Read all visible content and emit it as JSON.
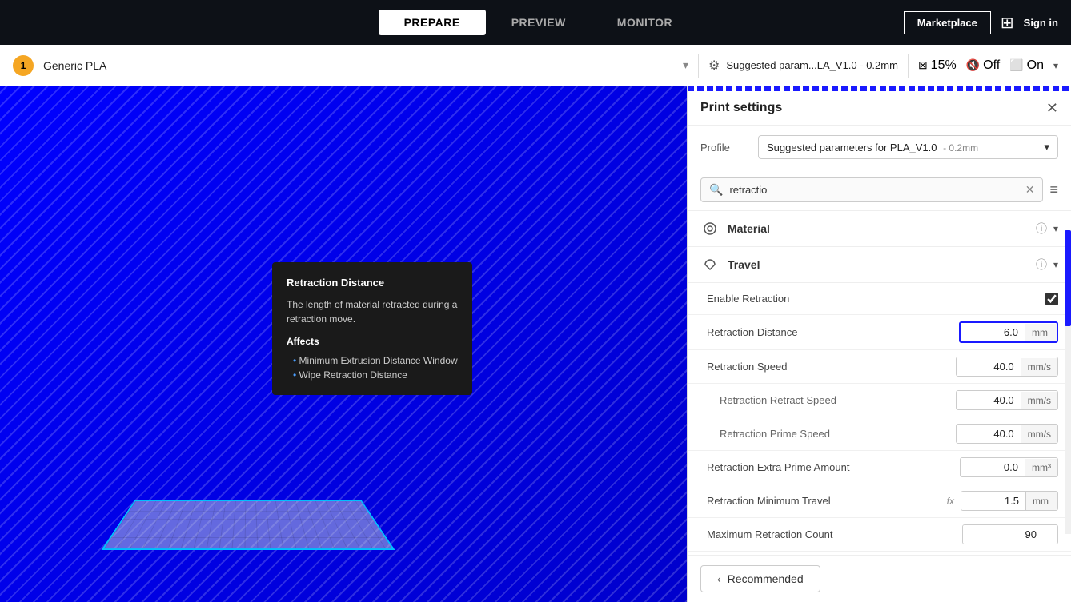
{
  "nav": {
    "tabs": [
      {
        "id": "prepare",
        "label": "PREPARE",
        "active": true
      },
      {
        "id": "preview",
        "label": "PREVIEW",
        "active": false
      },
      {
        "id": "monitor",
        "label": "MONITOR",
        "active": false
      }
    ],
    "marketplace_label": "Marketplace",
    "sign_in_label": "Sign in"
  },
  "toolbar": {
    "material_name": "Generic PLA",
    "suggested_params_text": "Suggested param...LA_V1.0 - 0.2mm",
    "infill_percent": "15%",
    "supports_label": "Off",
    "adhesion_label": "On"
  },
  "tooltip": {
    "title": "Retraction Distance",
    "description": "The length of material retracted during a retraction move.",
    "affects_label": "Affects",
    "affects_items": [
      "Minimum Extrusion Distance Window",
      "Wipe Retraction Distance"
    ]
  },
  "panel": {
    "title": "Print settings",
    "profile_label": "Profile",
    "profile_value": "Suggested parameters for PLA_V1.0",
    "profile_version": "- 0.2mm",
    "search_placeholder": "retractio",
    "sections": [
      {
        "id": "material",
        "label": "Material",
        "icon": "material-icon"
      },
      {
        "id": "travel",
        "label": "Travel",
        "icon": "travel-icon"
      }
    ],
    "settings": [
      {
        "id": "enable_retraction",
        "label": "Enable Retraction",
        "type": "checkbox",
        "value": true,
        "indented": false
      },
      {
        "id": "retraction_distance",
        "label": "Retraction Distance",
        "type": "number",
        "value": "6.0",
        "unit": "mm",
        "indented": false,
        "highlighted": true
      },
      {
        "id": "retraction_speed",
        "label": "Retraction Speed",
        "type": "number",
        "value": "40.0",
        "unit": "mm/s",
        "indented": false
      },
      {
        "id": "retraction_retract_speed",
        "label": "Retraction Retract Speed",
        "type": "number",
        "value": "40.0",
        "unit": "mm/s",
        "indented": true
      },
      {
        "id": "retraction_prime_speed",
        "label": "Retraction Prime Speed",
        "type": "number",
        "value": "40.0",
        "unit": "mm/s",
        "indented": true
      },
      {
        "id": "retraction_extra_prime_amount",
        "label": "Retraction Extra Prime Amount",
        "type": "number",
        "value": "0.0",
        "unit": "mm³",
        "indented": false
      },
      {
        "id": "retraction_minimum_travel",
        "label": "Retraction Minimum Travel",
        "type": "number",
        "value": "1.5",
        "unit": "mm",
        "indented": false,
        "has_fx": true
      },
      {
        "id": "maximum_retraction_count",
        "label": "Maximum Retraction Count",
        "type": "number",
        "value": "90",
        "unit": "",
        "indented": false
      }
    ],
    "recommended_btn_label": "Recommended"
  }
}
